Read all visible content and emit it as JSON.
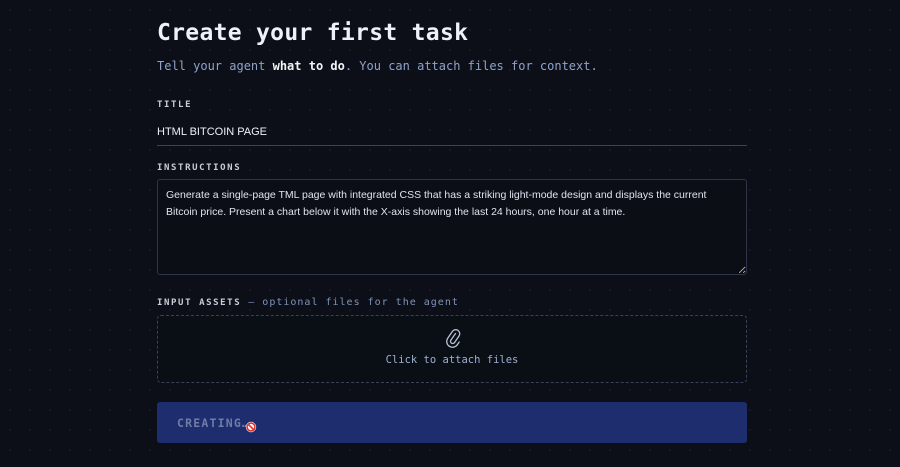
{
  "header": {
    "title": "Create your first task",
    "subtitle_before": "Tell your agent ",
    "subtitle_bold": "what to do",
    "subtitle_after": ". You can attach files for context."
  },
  "form": {
    "title_label": "TITLE",
    "title_value": "HTML BITCOIN PAGE",
    "instructions_label": "INSTRUCTIONS",
    "instructions_value": "Generate a single-page TML page with integrated CSS that has a striking light-mode design and displays the current Bitcoin price. Present a chart below it with the X-axis showing the last 24 hours, one hour at a time.",
    "assets_label": "INPUT ASSETS",
    "assets_separator": " — ",
    "assets_optional": "optional files for the agent",
    "attach_text": "Click to attach files",
    "attach_icon": "paperclip-icon",
    "submit_label": "CREATING…",
    "cursor_icon": "not-allowed-cursor-icon"
  },
  "colors": {
    "background": "#0c0f17",
    "button": "#1e2d6e",
    "muted_text": "#8fa3c9"
  }
}
